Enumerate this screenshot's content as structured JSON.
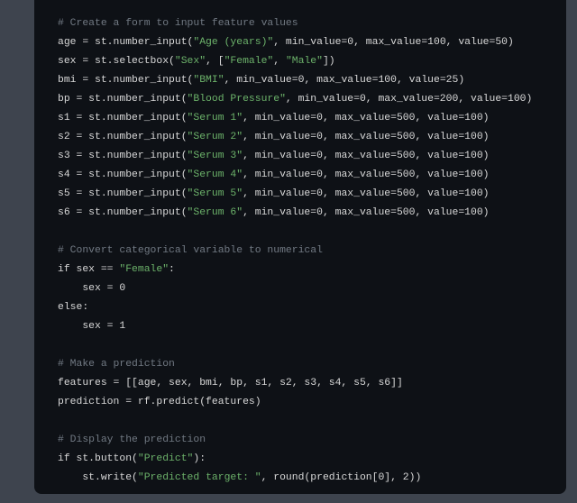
{
  "code": {
    "c1": "# Create a form to input feature values",
    "l_age_a": "age = st.number_input(",
    "s_age": "\"Age (years)\"",
    "l_age_b": ", min_value=0, max_value=100, value=50)",
    "l_sex_a": "sex = st.selectbox(",
    "s_sex_label": "\"Sex\"",
    "l_sex_mid": ", [",
    "s_sex_f": "\"Female\"",
    "l_sex_comma": ", ",
    "s_sex_m": "\"Male\"",
    "l_sex_b": "])",
    "l_bmi_a": "bmi = st.number_input(",
    "s_bmi": "\"BMI\"",
    "l_bmi_b": ", min_value=0, max_value=100, value=25)",
    "l_bp_a": "bp = st.number_input(",
    "s_bp": "\"Blood Pressure\"",
    "l_bp_b": ", min_value=0, max_value=200, value=100)",
    "l_s1_a": "s1 = st.number_input(",
    "s_s1": "\"Serum 1\"",
    "l_s1_b": ", min_value=0, max_value=500, value=100)",
    "l_s2_a": "s2 = st.number_input(",
    "s_s2": "\"Serum 2\"",
    "l_s2_b": ", min_value=0, max_value=500, value=100)",
    "l_s3_a": "s3 = st.number_input(",
    "s_s3": "\"Serum 3\"",
    "l_s3_b": ", min_value=0, max_value=500, value=100)",
    "l_s4_a": "s4 = st.number_input(",
    "s_s4": "\"Serum 4\"",
    "l_s4_b": ", min_value=0, max_value=500, value=100)",
    "l_s5_a": "s5 = st.number_input(",
    "s_s5": "\"Serum 5\"",
    "l_s5_b": ", min_value=0, max_value=500, value=100)",
    "l_s6_a": "s6 = st.number_input(",
    "s_s6": "\"Serum 6\"",
    "l_s6_b": ", min_value=0, max_value=500, value=100)",
    "c2": "# Convert categorical variable to numerical",
    "if_a": "if sex == ",
    "s_female": "\"Female\"",
    "if_b": ":",
    "sex0": "    sex = 0",
    "else": "else:",
    "sex1": "    sex = 1",
    "c3": "# Make a prediction",
    "feat": "features = [[age, sex, bmi, bp, s1, s2, s3, s4, s5, s6]]",
    "pred": "prediction = rf.predict(features)",
    "c4": "# Display the prediction",
    "btn_a": "if st.button(",
    "s_predict": "\"Predict\"",
    "btn_b": "):",
    "wr_a": "    st.write(",
    "s_out": "\"Predicted target: \"",
    "wr_b": ", round(prediction[0], 2))"
  }
}
